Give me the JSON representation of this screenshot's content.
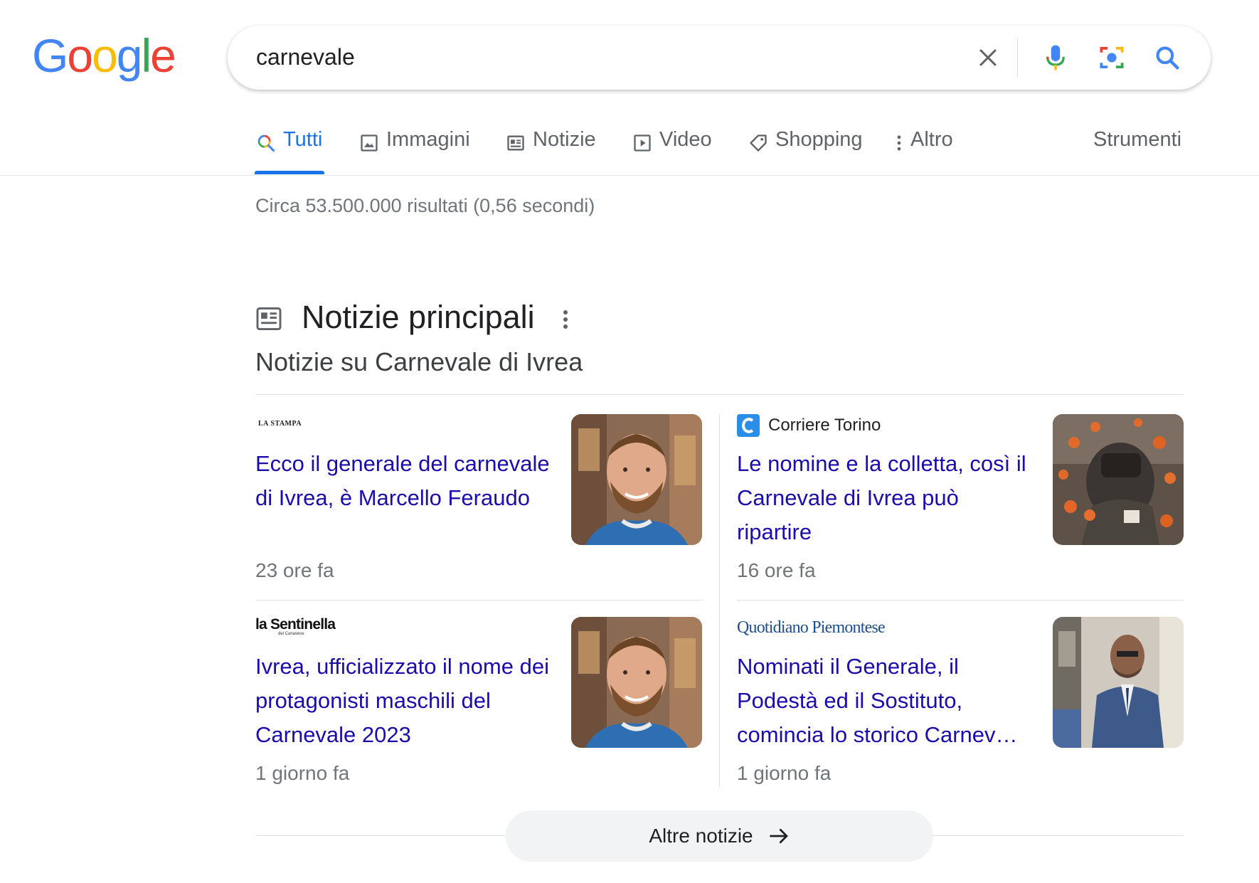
{
  "logo": {
    "text": "Google"
  },
  "search": {
    "query": "carnevale"
  },
  "tabs": [
    {
      "label": "Tutti"
    },
    {
      "label": "Immagini"
    },
    {
      "label": "Notizie"
    },
    {
      "label": "Video"
    },
    {
      "label": "Shopping"
    },
    {
      "label": "Altro"
    }
  ],
  "tools_label": "Strumenti",
  "results_count": "Circa 53.500.000 risultati (0,56 secondi)",
  "news": {
    "heading": "Notizie principali",
    "subheading": "Notizie su Carnevale di Ivrea",
    "items": [
      {
        "source": "LA STAMPA",
        "title": "Ecco il generale del carnevale di Ivrea, è Marcello Feraudo",
        "time": "23 ore fa"
      },
      {
        "source": "Corriere Torino",
        "title": "Le nomine e la colletta, così il Carnevale di Ivrea può ripartire",
        "time": "16 ore fa"
      },
      {
        "source": "la Sentinella",
        "source_sub": "del Canavese",
        "title": "Ivrea, ufficializzato il nome dei protagonisti maschili del Carnevale 2023",
        "time": "1 giorno fa"
      },
      {
        "source": "Quotidiano Piemontese",
        "title": "Nominati il Generale, il Podestà ed il Sostituto, comincia lo storico Carnev…",
        "time": "1 giorno fa"
      }
    ],
    "more_label": "Altre notizie"
  },
  "colors": {
    "link": "#1a0dab",
    "accent": "#1a73e8",
    "muted": "#70757a"
  }
}
